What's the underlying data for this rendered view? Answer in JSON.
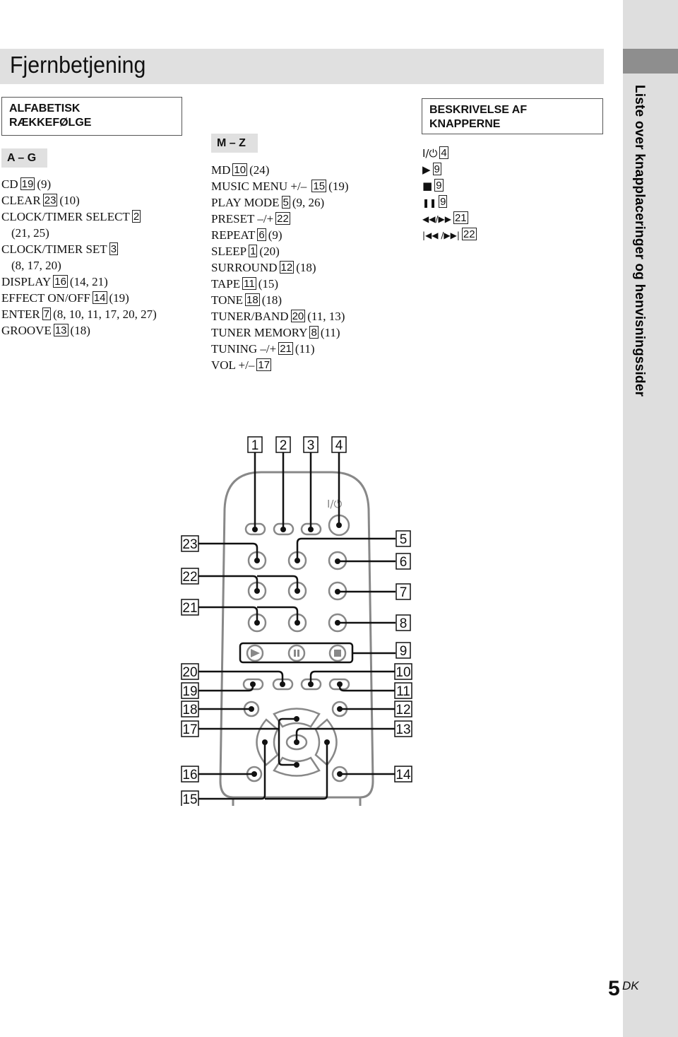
{
  "page": {
    "title": "Fjernbetjening",
    "side_tab_text": "Liste over knapplaceringer og henvisningssider",
    "page_number": "5",
    "page_suffix": "DK"
  },
  "alphabetical": {
    "heading": "ALFABETISK RÆKKEFØLGE",
    "heading_line1": "ALFABETISK",
    "heading_line2": "RÆKKEFØLGE",
    "group_ag": {
      "label": "A – G",
      "items": [
        {
          "name": "CD",
          "num": "19",
          "pages": "(9)"
        },
        {
          "name": "CLEAR",
          "num": "23",
          "pages": "(10)"
        },
        {
          "name": "CLOCK/TIMER SELECT",
          "num": "2",
          "pages": "(21, 25)"
        },
        {
          "name": "CLOCK/TIMER SET",
          "num": "3",
          "pages": "(8, 17, 20)"
        },
        {
          "name": "DISPLAY",
          "num": "16",
          "pages": "(14, 21)"
        },
        {
          "name": "EFFECT ON/OFF",
          "num": "14",
          "pages": "(19)"
        },
        {
          "name": "ENTER",
          "num": "7",
          "pages": "(8, 10, 11, 17, 20, 27)"
        },
        {
          "name": "GROOVE",
          "num": "13",
          "pages": "(18)"
        }
      ]
    },
    "group_mz": {
      "label": "M – Z",
      "items": [
        {
          "name": "MD",
          "num": "10",
          "pages": "(24)"
        },
        {
          "name": "MUSIC MENU +/–",
          "num": "15",
          "pages": "(19)"
        },
        {
          "name": "PLAY MODE",
          "num": "5",
          "pages": "(9, 26)"
        },
        {
          "name": "PRESET –/+",
          "num": "22",
          "pages": ""
        },
        {
          "name": "REPEAT",
          "num": "6",
          "pages": "(9)"
        },
        {
          "name": "SLEEP",
          "num": "1",
          "pages": "(20)"
        },
        {
          "name": "SURROUND",
          "num": "12",
          "pages": "(18)"
        },
        {
          "name": "TAPE",
          "num": "11",
          "pages": "(15)"
        },
        {
          "name": "TONE",
          "num": "18",
          "pages": "(18)"
        },
        {
          "name": "TUNER/BAND",
          "num": "20",
          "pages": "(11, 13)"
        },
        {
          "name": "TUNER MEMORY",
          "num": "8",
          "pages": "(11)"
        },
        {
          "name": "TUNING –/+",
          "num": "21",
          "pages": "(11)"
        },
        {
          "name": "VOL +/–",
          "num": "17",
          "pages": ""
        }
      ]
    }
  },
  "descriptions": {
    "heading_line1": "BESKRIVELSE AF",
    "heading_line2": "KNAPPERNE",
    "items": [
      {
        "icon": "power-icon",
        "symbol": "I/⏻",
        "num": "4"
      },
      {
        "icon": "play-icon",
        "symbol": "▶",
        "num": "9"
      },
      {
        "icon": "stop-icon",
        "symbol": "■",
        "num": "9"
      },
      {
        "icon": "pause-icon",
        "symbol": "❚❚",
        "num": "9"
      },
      {
        "icon": "rewind-fastforward-icon",
        "symbol": "◀◀/▶▶",
        "num": "21"
      },
      {
        "icon": "prev-next-track-icon",
        "symbol": "|◀◀ /▶▶|",
        "num": "22"
      }
    ]
  },
  "remote": {
    "power_label": "I/⏻",
    "callouts_top": [
      "1",
      "2",
      "3",
      "4"
    ],
    "callouts_left": [
      "23",
      "22",
      "21",
      "20",
      "19",
      "18",
      "17",
      "16",
      "15"
    ],
    "callouts_right": [
      "5",
      "6",
      "7",
      "8",
      "9",
      "10",
      "11",
      "12",
      "13",
      "14"
    ]
  }
}
